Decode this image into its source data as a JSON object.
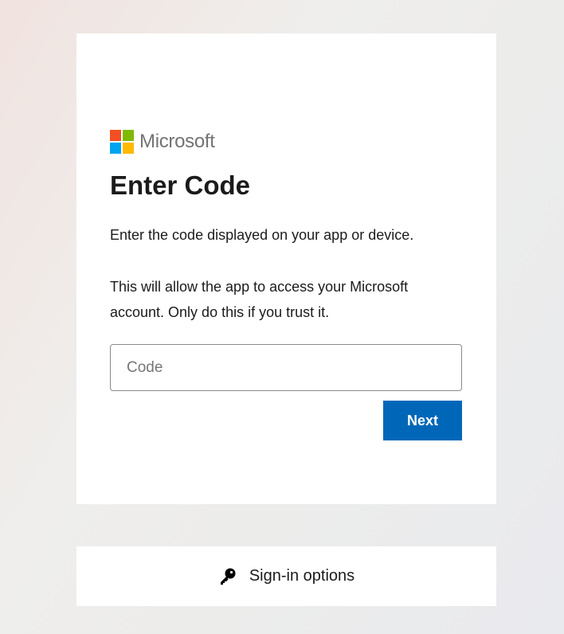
{
  "brand": {
    "name": "Microsoft",
    "logo_colors": [
      "#f25022",
      "#7fba00",
      "#00a4ef",
      "#ffb900"
    ]
  },
  "page": {
    "title": "Enter Code",
    "description": "Enter the code displayed on your app or device.",
    "warning": "This will allow the app to access your Microsoft account. Only do this if you trust it."
  },
  "form": {
    "code_placeholder": "Code",
    "code_value": "",
    "next_label": "Next",
    "accent_color": "#0067b8"
  },
  "signin_options": {
    "icon": "key-icon",
    "label": "Sign-in options"
  }
}
